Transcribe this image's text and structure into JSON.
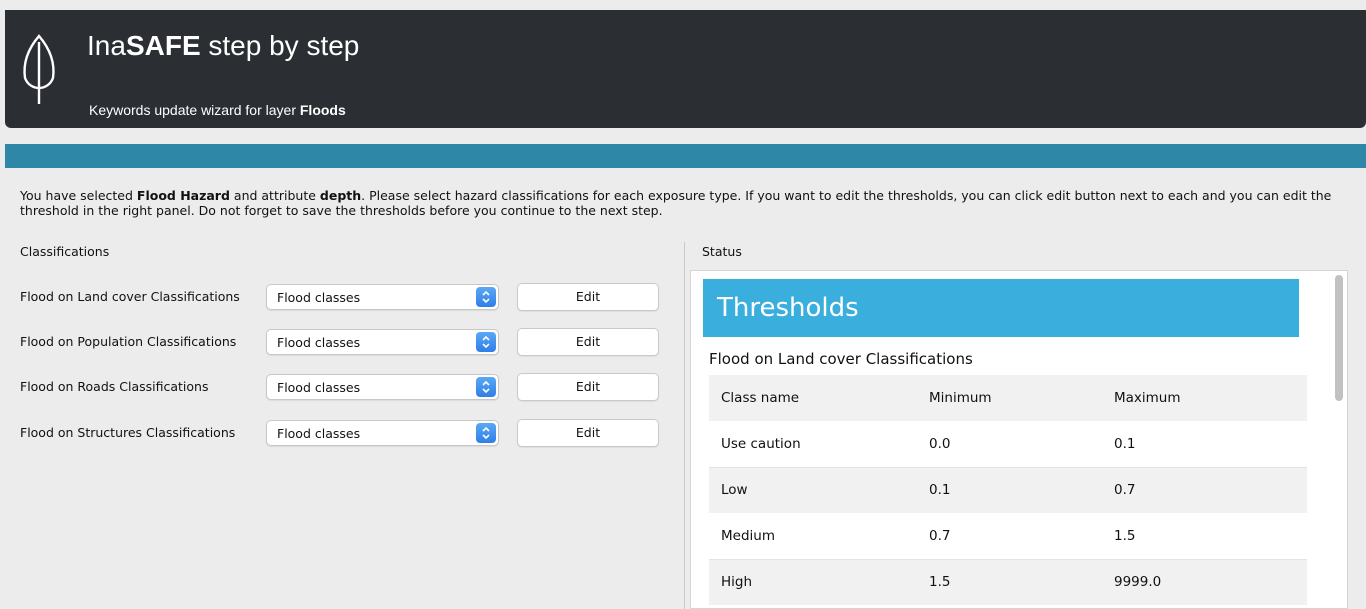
{
  "header": {
    "title_prefix": "Ina",
    "title_bold": "SAFE",
    "title_suffix": " step by step",
    "subtitle_prefix": "Keywords update wizard for layer ",
    "subtitle_layer": "Floods",
    "logo_icon": "inasafe-leaf-logo-icon"
  },
  "intro": {
    "p1": "You have selected ",
    "hazard": "Flood Hazard",
    "p2": " and attribute ",
    "attribute": "depth",
    "p3": ". Please select hazard classifications for each exposure type. If you want to edit the thresholds, you can click edit button next to each and you can edit the threshold in the right panel. Do not forget to save the thresholds before you continue to the next step."
  },
  "classifications": {
    "heading": "Classifications",
    "rows": [
      {
        "label": "Flood on Land cover Classifications",
        "value": "Flood classes",
        "button": "Edit"
      },
      {
        "label": "Flood on Population Classifications",
        "value": "Flood classes",
        "button": "Edit"
      },
      {
        "label": "Flood on Roads Classifications",
        "value": "Flood classes",
        "button": "Edit"
      },
      {
        "label": "Flood on Structures Classifications",
        "value": "Flood classes",
        "button": "Edit"
      }
    ]
  },
  "status": {
    "heading": "Status",
    "banner": "Thresholds",
    "table_title": "Flood on Land cover Classifications",
    "columns": [
      "Class name",
      "Minimum",
      "Maximum"
    ],
    "rows": [
      [
        "Use caution",
        "0.0",
        "0.1"
      ],
      [
        "Low",
        "0.1",
        "0.7"
      ],
      [
        "Medium",
        "0.7",
        "1.5"
      ],
      [
        "High",
        "1.5",
        "9999.0"
      ]
    ]
  },
  "colors": {
    "header_bg": "#2b2f33",
    "progress_strip": "#2e87a6",
    "banner": "#3aaedc",
    "combo_arrow": "#2f7fe8"
  }
}
